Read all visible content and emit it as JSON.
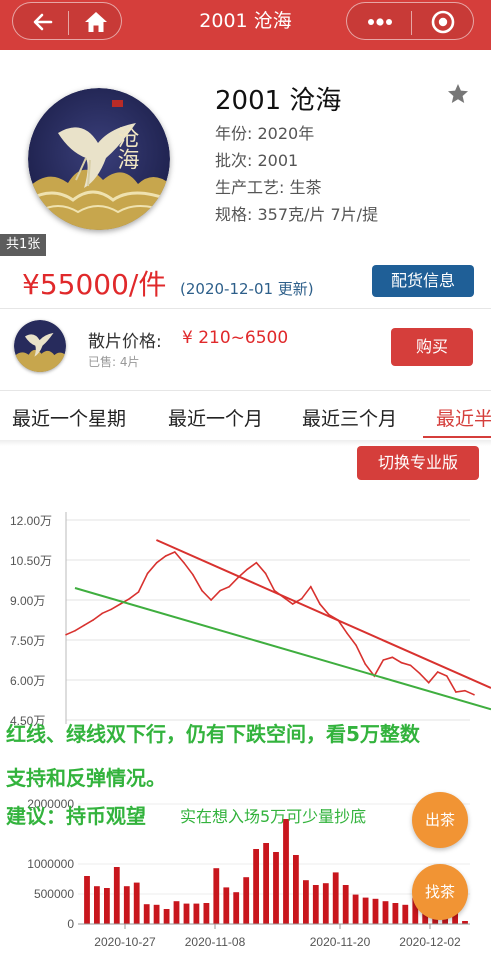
{
  "nav": {
    "title": "2001 沧海",
    "back_icon": "back-arrow-icon",
    "home_icon": "home-icon",
    "more_icon": "more-dots-icon",
    "close_icon": "target-icon"
  },
  "product": {
    "name": "2001 沧海",
    "image_text": "沧海",
    "year": "年份: 2020年",
    "batch": "批次: 2001",
    "process": "生产工艺: 生茶",
    "spec": "规格: 357克/片 7片/提",
    "count_badge": "共1张",
    "price": "¥55000/件",
    "update": "(2020-12-01 更新)",
    "match_button": "配货信息"
  },
  "loose": {
    "label": "散片价格:",
    "price": "¥ 210~6500",
    "sold": "已售: 4片",
    "buy_button": "购买"
  },
  "tabs": [
    "最近一个星期",
    "最近一个月",
    "最近三个月",
    "最近半"
  ],
  "pro_button": "切换专业版",
  "annotations": {
    "line1": "红线、绿线双下行，仍有下跌空间，看5万整数",
    "line2": "支持和反弹情况。",
    "line3": "建议：持币观望",
    "line3_note": "实在想入场5万可少量抄底"
  },
  "floats": {
    "sell": "出茶",
    "find": "找茶"
  },
  "colors": {
    "brand_red": "#d53e3b",
    "price_red": "#e0292b",
    "info_blue": "#1f5f97",
    "note_green": "#33b33d",
    "float_orange": "#f19434",
    "trend_red": "#d8322f",
    "trend_green": "#3fae3f",
    "bar_red": "#c8161d"
  },
  "chart_data": [
    {
      "type": "line",
      "ylabel": "",
      "yticks": [
        "12.00万",
        "10.50万",
        "9.00万",
        "7.50万",
        "6.00万",
        "4.50万"
      ],
      "ylim": [
        45000,
        120000
      ],
      "x_range": [
        "2020-10-20",
        "2020-12-06"
      ],
      "x_tick_labels": [
        "2020-10-27",
        "2020-11-08",
        "2020-11-20",
        "2020-12-02"
      ],
      "grid": true,
      "series": [
        {
          "values": [
            77000,
            78500,
            80500,
            82500,
            85000,
            86500,
            88500,
            90500,
            93000,
            100000,
            104000,
            106500,
            108000,
            104000,
            99500,
            93500,
            90000,
            93500,
            95000,
            98500,
            101500,
            104000,
            100000,
            93500,
            91000,
            88500,
            90500,
            95000,
            88500,
            84500,
            82500,
            77500,
            73000,
            66000,
            61500,
            67500,
            68500,
            66500,
            65500,
            62500,
            59000,
            63000,
            61500,
            55500,
            56000,
            54500
          ]
        }
      ],
      "trendlines": [
        {
          "color": "red",
          "from": [
            "2020-10-30",
            112500
          ],
          "to": [
            "2020-12-06",
            57000
          ]
        },
        {
          "color": "green",
          "from": [
            "2020-10-21",
            94500
          ],
          "to": [
            "2020-12-06",
            49000
          ]
        }
      ]
    },
    {
      "type": "bar",
      "yticks": [
        "2000000",
        "1000000",
        "500000",
        "0"
      ],
      "ylim": [
        0,
        2000000
      ],
      "x_tick_labels": [
        "2020-10-27",
        "2020-11-08",
        "2020-11-20",
        "2020-12-02"
      ],
      "values": [
        800000,
        630000,
        600000,
        950000,
        630000,
        690000,
        330000,
        320000,
        250000,
        380000,
        340000,
        340000,
        350000,
        930000,
        610000,
        530000,
        780000,
        1250000,
        1350000,
        1200000,
        1750000,
        1150000,
        730000,
        650000,
        680000,
        860000,
        650000,
        490000,
        440000,
        420000,
        380000,
        350000,
        320000,
        440000,
        250000,
        230000,
        220000,
        230000,
        50000
      ]
    }
  ]
}
